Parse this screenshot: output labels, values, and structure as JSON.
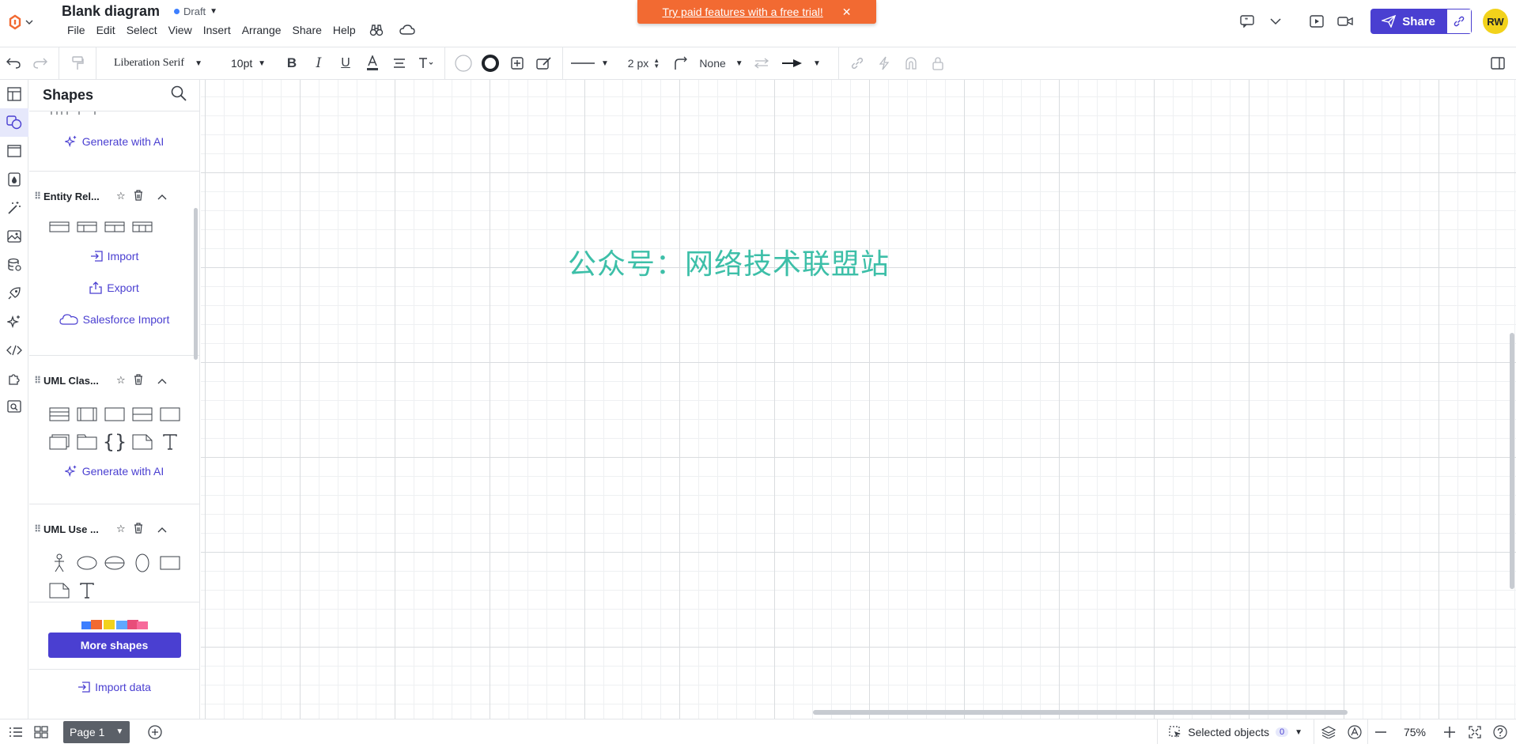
{
  "header": {
    "title": "Blank diagram",
    "status": "Draft",
    "menu": [
      "File",
      "Edit",
      "Select",
      "View",
      "Insert",
      "Arrange",
      "Share",
      "Help"
    ],
    "promo_text": "Try paid features with a free trial!",
    "share_label": "Share",
    "avatar_initials": "RW"
  },
  "toolbar": {
    "font_family": "Liberation Serif",
    "font_size": "10pt",
    "line_width": "2 px",
    "endpoint": "None"
  },
  "panel": {
    "title": "Shapes",
    "top_link": "Generate with AI",
    "sections": [
      {
        "name": "Entity Rel...",
        "links": [
          "Import",
          "Export",
          "Salesforce Import"
        ]
      },
      {
        "name": "UML Clas...",
        "links": [
          "Generate with AI"
        ]
      },
      {
        "name": "UML Use ..."
      }
    ],
    "more_shapes": "More shapes",
    "import_data": "Import data"
  },
  "canvas": {
    "watermark": "公众号：网络技术联盟站"
  },
  "bottombar": {
    "page_label": "Page 1",
    "selected_objects_label": "Selected objects",
    "selected_count": "0",
    "zoom": "75%"
  },
  "colors": {
    "accent": "#4a3fd1",
    "promo": "#f26a32",
    "watermark": "#3dbfa8",
    "avatar": "#f2d21b"
  }
}
